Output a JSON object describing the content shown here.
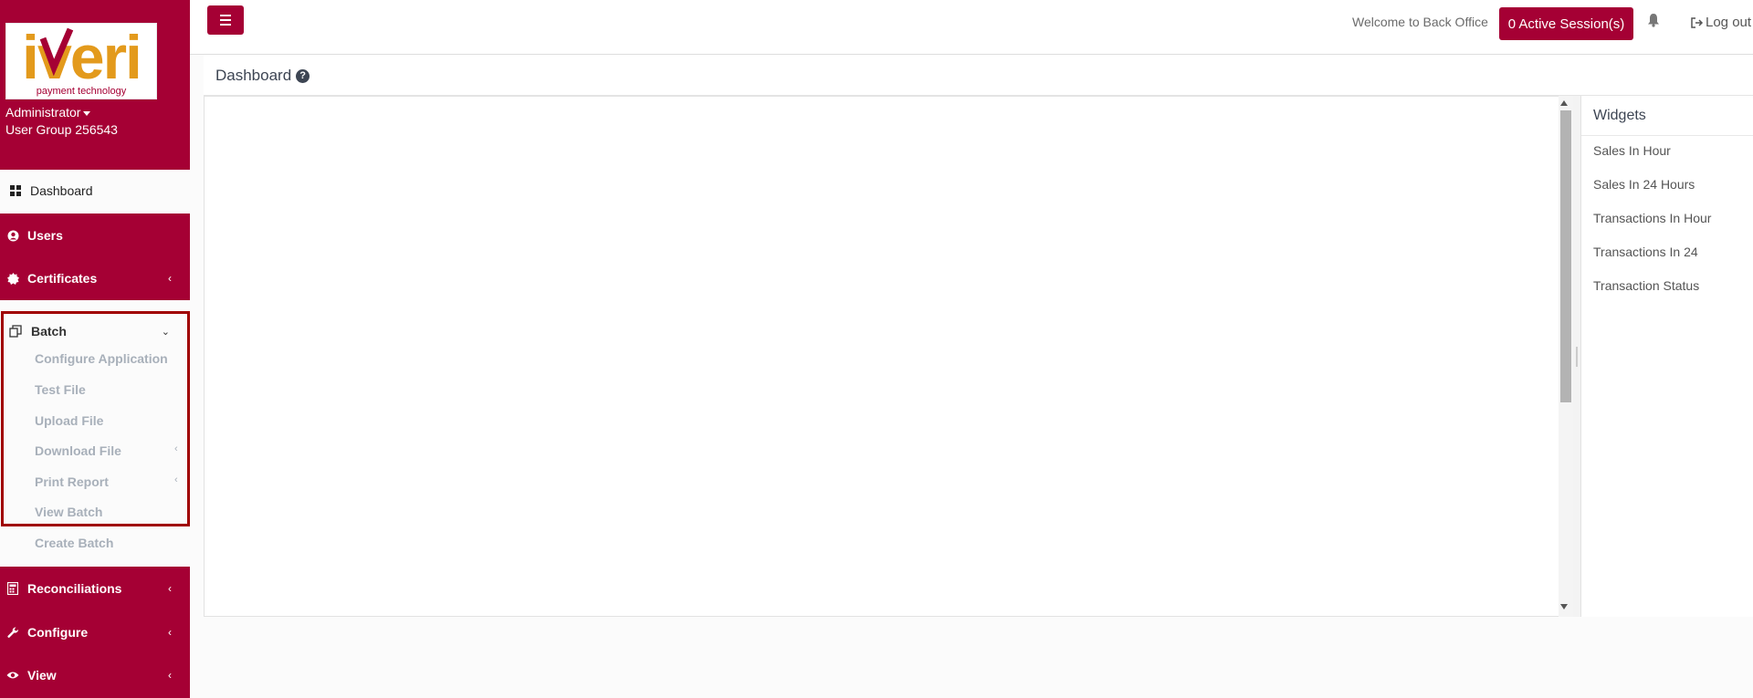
{
  "brand": {
    "logo_text": "iveri",
    "logo_tagline": "payment technology",
    "user_name": "Administrator",
    "user_group": "User Group 256543"
  },
  "nav": {
    "dashboard": "Dashboard",
    "users": "Users",
    "certificates": "Certificates",
    "batch": "Batch",
    "batch_items": [
      "Configure Application",
      "Test File",
      "Upload File",
      "Download File",
      "Print Report",
      "View Batch",
      "Create Batch"
    ],
    "reconciliations": "Reconciliations",
    "configure": "Configure",
    "view": "View"
  },
  "topbar": {
    "welcome": "Welcome to Back Office",
    "sessions": "0 Active Session(s)",
    "logout": "Log out"
  },
  "page": {
    "title": "Dashboard"
  },
  "widgets": {
    "title": "Widgets",
    "items": [
      "Sales In Hour",
      "Sales In 24 Hours",
      "Transactions In Hour",
      "Transactions In 24",
      "Transaction Status"
    ]
  },
  "colors": {
    "brand": "#a50034",
    "logo_orange": "#e39a1c",
    "batch_border": "#a00000"
  },
  "icons": {
    "dashboard": "grid-icon",
    "users": "user-circle-icon",
    "certificates": "certificate-icon",
    "batch": "copy-icon",
    "reconciliations": "calculator-icon",
    "configure": "wrench-icon",
    "view": "eye-icon",
    "bell": "bell-icon",
    "logout": "sign-out-icon",
    "help": "question-circle-icon"
  }
}
